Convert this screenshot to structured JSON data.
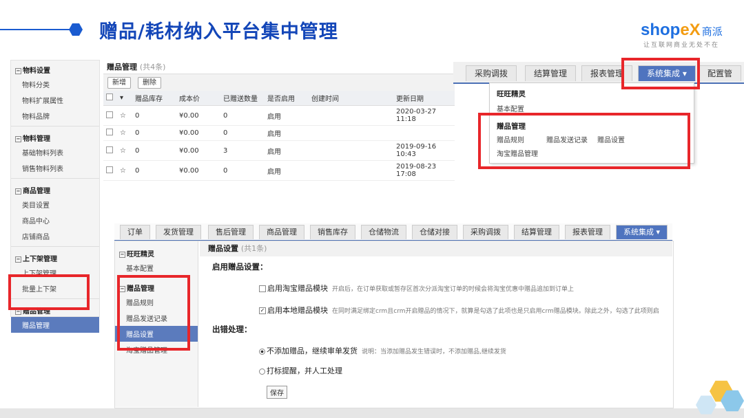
{
  "slide": {
    "title": "赠品/耗材纳入平台集中管理",
    "logo_main": "shop",
    "logo_x": "eX",
    "logo_cn": "商派",
    "logo_sub": "让互联网商业无处不在"
  },
  "sidebar": {
    "groups": [
      {
        "label": "物料设置",
        "items": [
          "物料分类",
          "物料扩展属性",
          "物料品牌"
        ]
      },
      {
        "label": "物料管理",
        "items": [
          "基础物料列表",
          "销售物料列表"
        ]
      },
      {
        "label": "商品管理",
        "items": [
          "类目设置",
          "商品中心",
          "店铺商品"
        ]
      },
      {
        "label": "上下架管理",
        "items": [
          "上下架管理",
          "批量上下架"
        ]
      },
      {
        "label": "赠品管理",
        "items": [
          "赠品管理"
        ]
      }
    ]
  },
  "gift_table": {
    "title": "赠品管理",
    "count": "(共4条)",
    "add_label": "新增",
    "delete_label": "删除",
    "columns": [
      "赠品库存",
      "成本价",
      "已赠送数量",
      "是否启用",
      "创建时间",
      "更新日期"
    ],
    "rows": [
      [
        "0",
        "¥0.00",
        "0",
        "启用",
        "",
        "2020-03-27 11:18"
      ],
      [
        "0",
        "¥0.00",
        "0",
        "启用",
        "",
        ""
      ],
      [
        "0",
        "¥0.00",
        "3",
        "启用",
        "",
        "2019-09-16 10:43"
      ],
      [
        "0",
        "¥0.00",
        "0",
        "启用",
        "",
        "2019-08-23 17:08"
      ]
    ]
  },
  "top_nav": {
    "tabs": [
      "采购调拨",
      "结算管理",
      "报表管理",
      "系统集成 ▾",
      "配置管"
    ]
  },
  "dropdown": {
    "group1": "旺旺精灵",
    "group1_item": "基本配置",
    "group2": "赠品管理",
    "items": [
      "赠品规则",
      "赠品发送记录",
      "赠品设置"
    ],
    "taobao": "淘宝赠品管理"
  },
  "bottom_nav": {
    "tabs": [
      "订单",
      "发货管理",
      "售后管理",
      "商品管理",
      "销售库存",
      "仓储物流",
      "仓储对接",
      "采购调拨",
      "结算管理",
      "报表管理",
      "系统集成 ▾"
    ]
  },
  "bottom_side": {
    "group1": "旺旺精灵",
    "group1_item": "基本配置",
    "group2": "赠品管理",
    "items": [
      "赠品规则",
      "赠品发送记录",
      "赠品设置",
      "淘宝赠品管理"
    ]
  },
  "settings": {
    "title": "赠品设置",
    "count": "(共1条)",
    "enable_section": "启用赠品设置：",
    "opt1_label": "启用淘宝赠品模块",
    "opt1_note": "开启后，在订单获取或暂存区首次分派淘宝订单的时候会将淘宝优惠中赠品追加到订单上",
    "opt2_label": "启用本地赠品模块",
    "opt2_note": "在同时满足绑定crm且crm开启赠品的情况下，就算是勾选了此项也是只启用crm赠品模块。除此之外，勾选了此项则启",
    "error_section": "出错处理：",
    "radio1_label": "不添加赠品，继续审单发货",
    "radio1_note": "说明：当添加赠品发生错误时，不添加赠品,继续发货",
    "radio2_label": "打标提醒，并人工处理",
    "save_label": "保存"
  }
}
